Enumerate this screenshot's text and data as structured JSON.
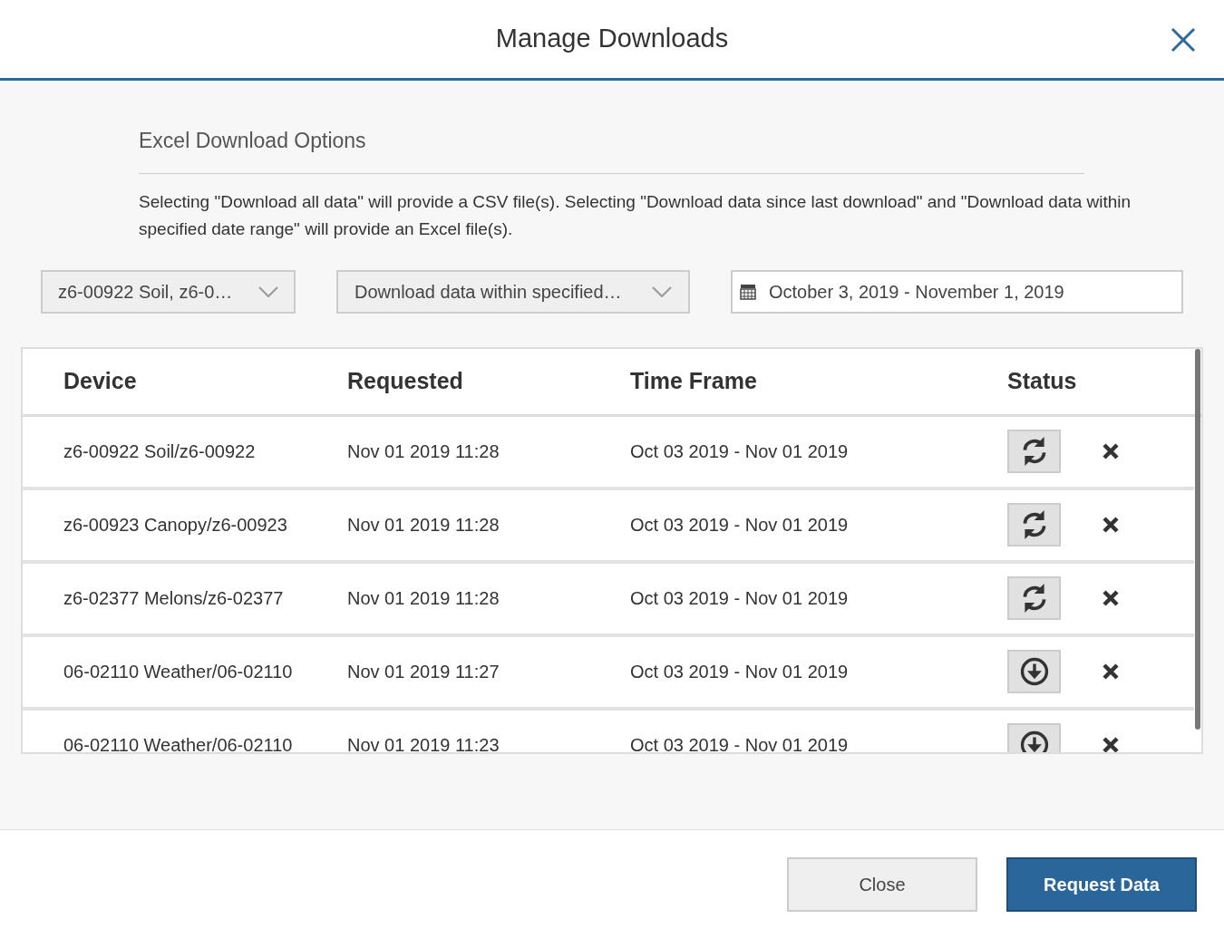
{
  "dialog": {
    "title": "Manage Downloads"
  },
  "section": {
    "heading": "Excel Download Options",
    "description": "Selecting \"Download all data\" will provide a CSV file(s). Selecting \"Download data since last download\" and \"Download data within specified date range\" will provide an Excel file(s)."
  },
  "filters": {
    "devices": "z6-00922 Soil, z6-0…",
    "mode": "Download data within specified…",
    "date_range": "October 3, 2019 - November 1, 2019"
  },
  "table": {
    "columns": [
      "Device",
      "Requested",
      "Time Frame",
      "Status"
    ],
    "rows": [
      {
        "device": "z6-00922 Soil/z6-00922",
        "requested": "Nov 01 2019 11:28",
        "time_frame": "Oct 03 2019 - Nov 01 2019",
        "kind": "pending"
      },
      {
        "device": "z6-00923 Canopy/z6-00923",
        "requested": "Nov 01 2019 11:28",
        "time_frame": "Oct 03 2019 - Nov 01 2019",
        "kind": "pending"
      },
      {
        "device": "z6-02377 Melons/z6-02377",
        "requested": "Nov 01 2019 11:28",
        "time_frame": "Oct 03 2019 - Nov 01 2019",
        "kind": "pending"
      },
      {
        "device": "06-02110 Weather/06-02110",
        "requested": "Nov 01 2019 11:27",
        "time_frame": "Oct 03 2019 - Nov 01 2019",
        "kind": "ready"
      },
      {
        "device": "06-02110 Weather/06-02110",
        "requested": "Nov 01 2019 11:23",
        "time_frame": "Oct 03 2019 - Nov 01 2019",
        "kind": "ready"
      }
    ]
  },
  "buttons": {
    "close": "Close",
    "primary": "Request Data"
  }
}
